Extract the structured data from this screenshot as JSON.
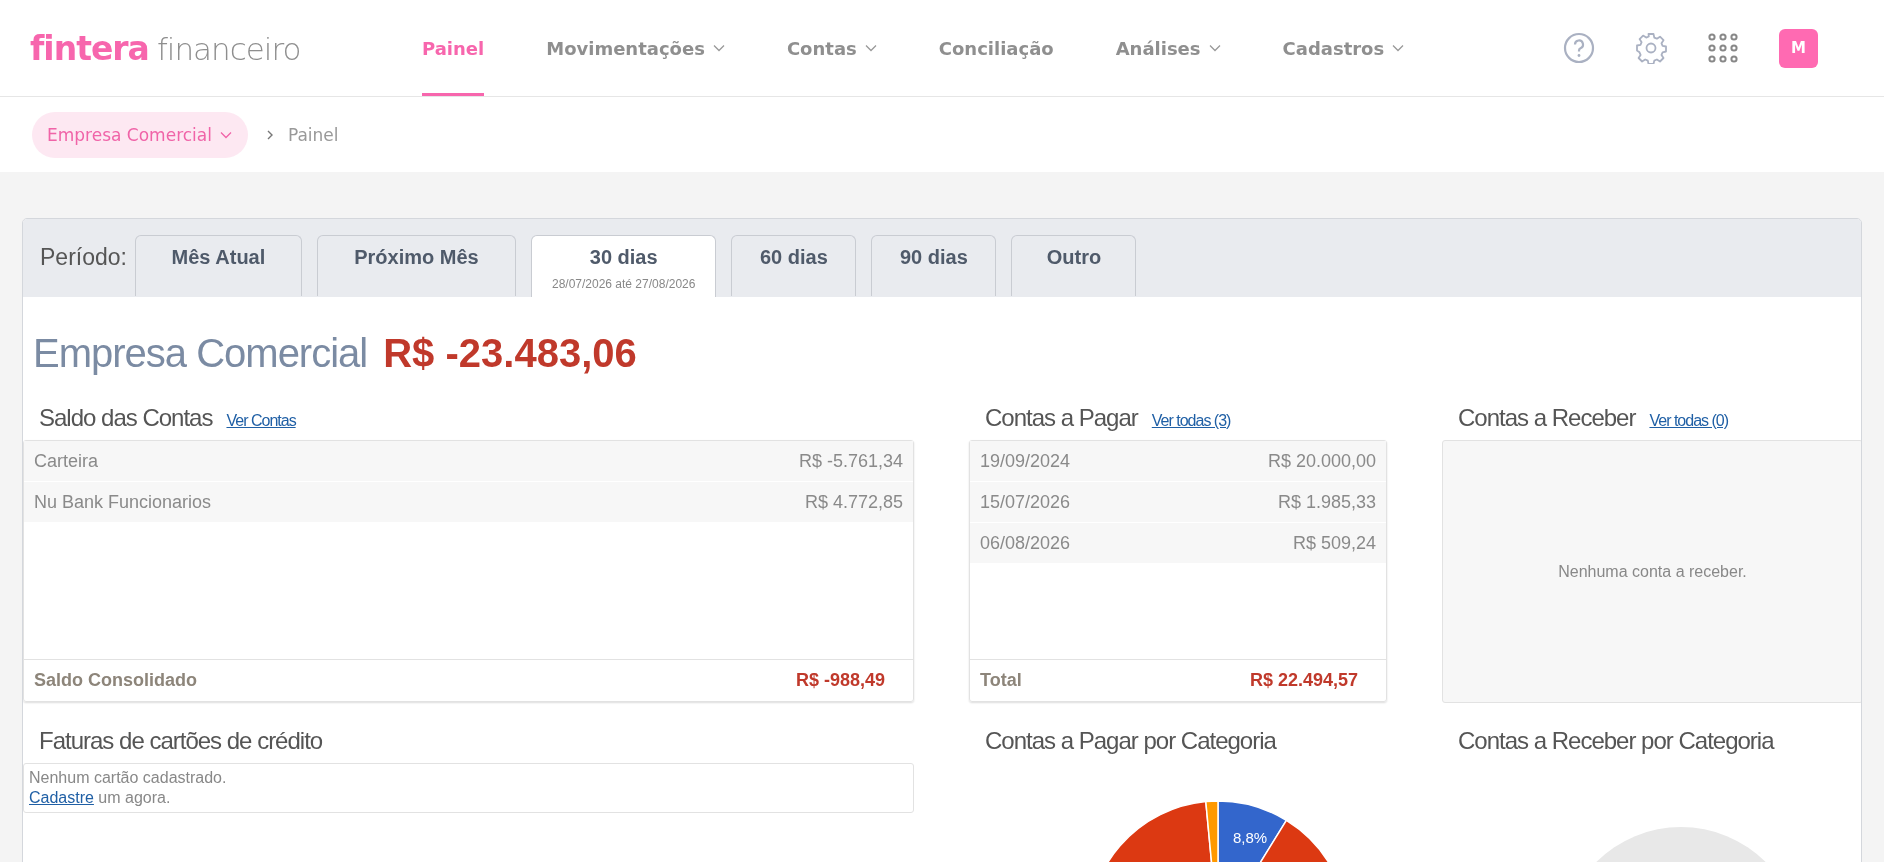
{
  "brand": {
    "logo": "fintera",
    "suffix": "financeiro"
  },
  "nav": [
    {
      "label": "Painel",
      "selected": true,
      "dropdown": false
    },
    {
      "label": "Movimentações",
      "selected": false,
      "dropdown": true
    },
    {
      "label": "Contas",
      "selected": false,
      "dropdown": true
    },
    {
      "label": "Conciliação",
      "selected": false,
      "dropdown": false
    },
    {
      "label": "Análises",
      "selected": false,
      "dropdown": true
    },
    {
      "label": "Cadastros",
      "selected": false,
      "dropdown": true
    }
  ],
  "user": {
    "avatar": "M"
  },
  "breadcrumb": {
    "company": "Empresa Comercial",
    "page": "Painel"
  },
  "period": {
    "label": "Período:",
    "tabs": [
      {
        "label": "Mês Atual",
        "selected": false
      },
      {
        "label": "Próximo Mês",
        "selected": false
      },
      {
        "label": "30 dias",
        "selected": true,
        "subtitle": "28/07/2026 até 27/08/2026"
      },
      {
        "label": "60 dias",
        "selected": false
      },
      {
        "label": "90 dias",
        "selected": false
      },
      {
        "label": "Outro",
        "selected": false
      }
    ]
  },
  "summary": {
    "company": "Empresa Comercial",
    "amount": "R$ -23.483,06"
  },
  "balances": {
    "title": "Saldo das Contas",
    "link": "Ver Contas",
    "rows": [
      {
        "name": "Carteira",
        "value": "R$ -5.761,34"
      },
      {
        "name": "Nu Bank Funcionarios",
        "value": "R$ 4.772,85"
      }
    ],
    "total_label": "Saldo Consolidado",
    "total": "R$ -988,49"
  },
  "payables": {
    "title": "Contas a Pagar",
    "link": "Ver todas (3)",
    "rows": [
      {
        "date": "19/09/2024",
        "value": "R$ 20.000,00"
      },
      {
        "date": "15/07/2026",
        "value": "R$ 1.985,33"
      },
      {
        "date": "06/08/2026",
        "value": "R$ 509,24"
      }
    ],
    "total_label": "Total",
    "total": "R$ 22.494,57"
  },
  "receivables": {
    "title": "Contas a Receber",
    "link": "Ver todas (0)",
    "empty": "Nenhuma conta a receber."
  },
  "cards": {
    "title": "Faturas de cartões de crédito",
    "empty": "Nenhum cartão cadastrado.",
    "link": "Cadastre",
    "rest": "um agora."
  },
  "payables_by_category": {
    "title": "Contas a Pagar por Categoria",
    "slice_label": "8,8%"
  },
  "receivables_by_category": {
    "title": "Contas a Receber por Categoria"
  }
}
